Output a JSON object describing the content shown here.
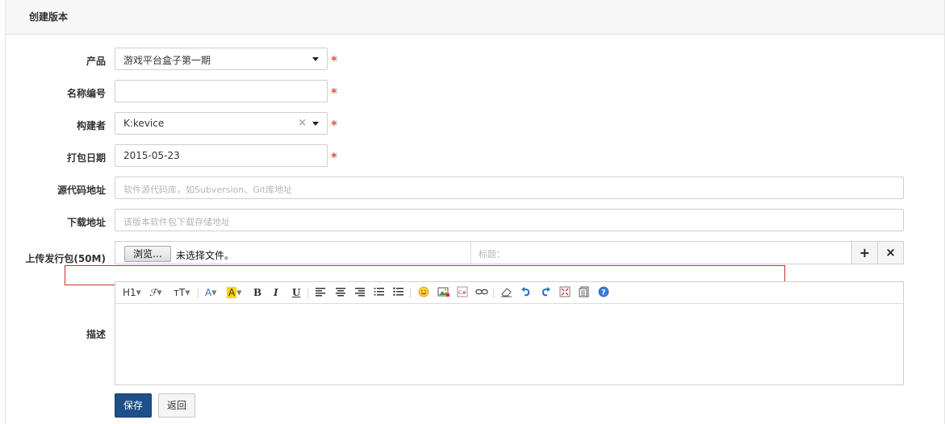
{
  "panel": {
    "title": "创建版本"
  },
  "form": {
    "product": {
      "label": "产品",
      "value": "游戏平台盒子第一期",
      "required_mark": "*"
    },
    "name": {
      "label": "名称编号",
      "value": "",
      "required_mark": "*"
    },
    "builder": {
      "label": "构建者",
      "value": "K:kevice",
      "clear": "×",
      "required_mark": "*"
    },
    "date": {
      "label": "打包日期",
      "value": "2015-05-23",
      "required_mark": "*"
    },
    "source": {
      "label": "源代码地址",
      "placeholder": "软件源代码库，如Subversion、Git库地址"
    },
    "download": {
      "label": "下载地址",
      "placeholder": "该版本软件包下载存储地址"
    },
    "upload": {
      "label": "上传发行包(50M)",
      "browse_label": "浏览…",
      "file_status": "未选择文件。",
      "title_placeholder": "标题：",
      "add": "+",
      "remove": "×"
    },
    "description": {
      "label": "描述"
    }
  },
  "editor_toolbar": {
    "heading": "H1",
    "font": "ℱ",
    "size": "тT",
    "font_color": "A",
    "highlight": "A",
    "bold": "B",
    "italic": "I",
    "underline": "U"
  },
  "actions": {
    "save": "保存",
    "back": "返回"
  },
  "colors": {
    "primary": "#1e4f8a",
    "required": "#d9534f",
    "highlight_box": "#c4302b"
  }
}
